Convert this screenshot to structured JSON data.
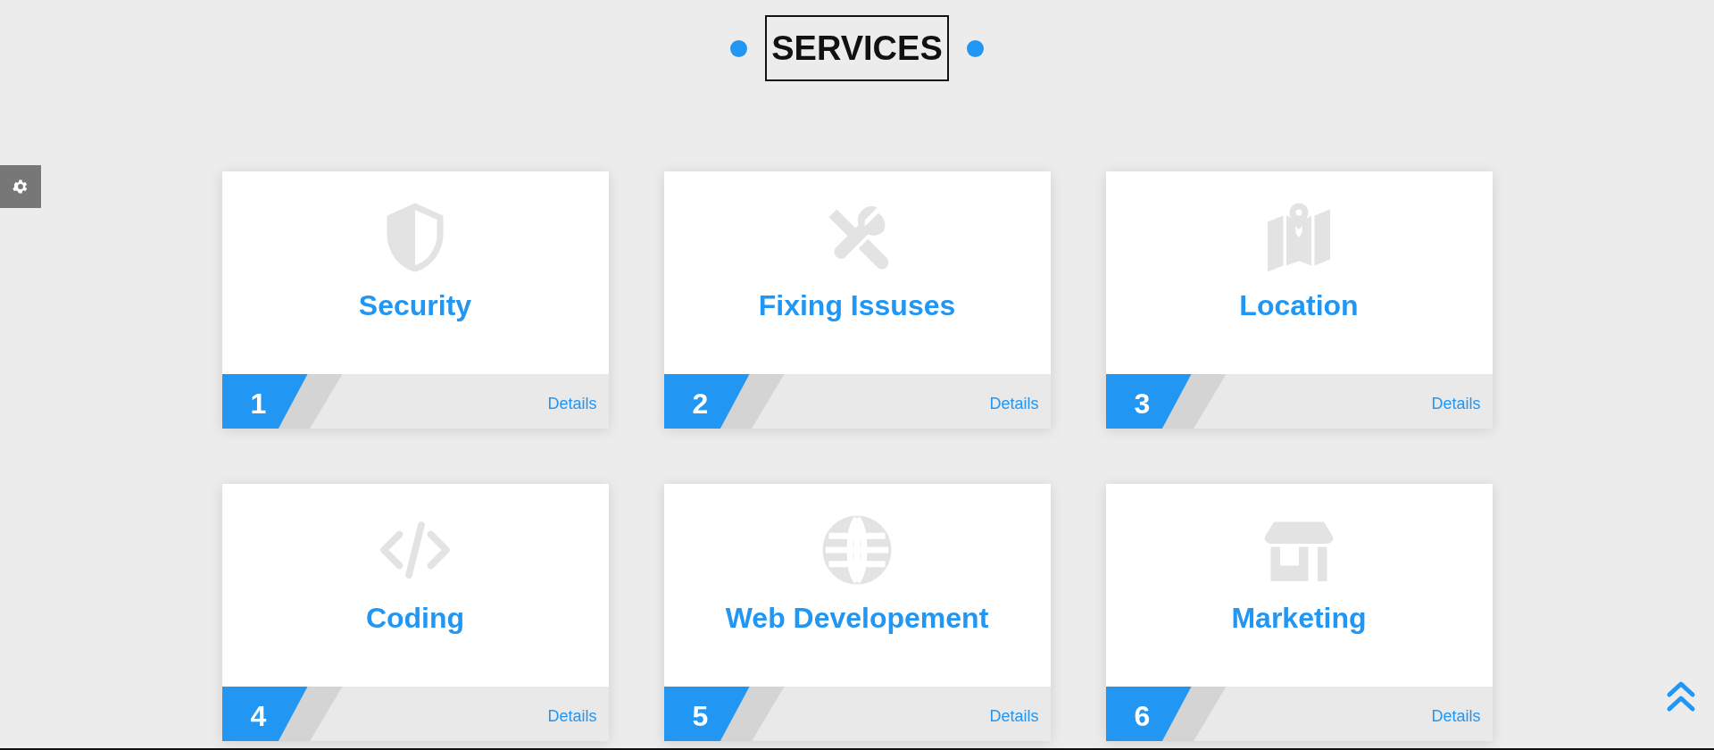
{
  "heading": "SERVICES",
  "cards": [
    {
      "title": "Security",
      "number": "1",
      "link": "Details"
    },
    {
      "title": "Fixing Issuses",
      "number": "2",
      "link": "Details"
    },
    {
      "title": "Location",
      "number": "3",
      "link": "Details"
    },
    {
      "title": "Coding",
      "number": "4",
      "link": "Details"
    },
    {
      "title": "Web Developement",
      "number": "5",
      "link": "Details"
    },
    {
      "title": "Marketing",
      "number": "6",
      "link": "Details"
    }
  ]
}
